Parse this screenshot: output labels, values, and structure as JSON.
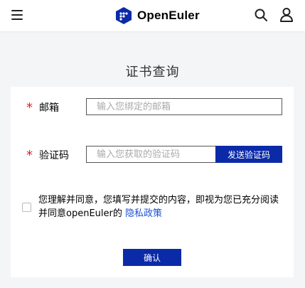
{
  "header": {
    "brand": "OpenEuler",
    "icons": [
      "menu-icon",
      "logo-icon",
      "search-icon",
      "user-icon"
    ],
    "brand_color": "#0b2aa8"
  },
  "page": {
    "title": "证书查询"
  },
  "form": {
    "required_mark": "*",
    "email_label": "邮箱",
    "email_placeholder": "输入您绑定的邮箱",
    "code_label": "验证码",
    "code_placeholder": "输入您获取的验证码",
    "send_code_label": "发送验证码",
    "consent_text": "您理解并同意，您填写并提交的内容，即视为您已充分阅读并同意openEuler的 ",
    "privacy_link": "隐私政策",
    "confirm_label": "确认"
  },
  "colors": {
    "primary_button": "#0b2aa8",
    "required_star": "#e02020",
    "link": "#1a4fd6",
    "page_background": "#f4f5f7"
  }
}
